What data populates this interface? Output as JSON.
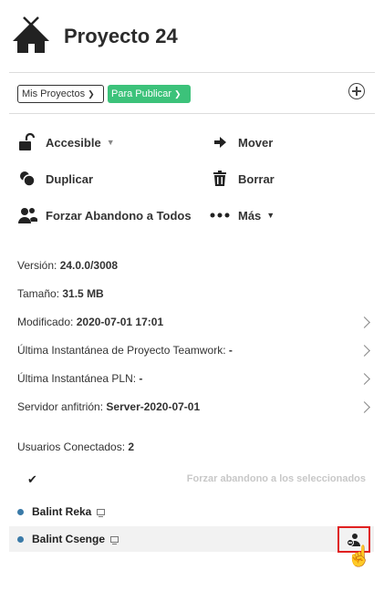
{
  "project": {
    "title": "Proyecto 24"
  },
  "filters": {
    "projects_label": "Mis Proyectos",
    "status_label": "Para Publicar"
  },
  "actions": {
    "accessible": "Accesible",
    "move": "Mover",
    "duplicate": "Duplicar",
    "delete": "Borrar",
    "force_leave_all": "Forzar Abandono a Todos",
    "more": "Más"
  },
  "info": {
    "version_label": "Versión:",
    "version_value": "24.0.0/3008",
    "size_label": "Tamaño:",
    "size_value": "31.5 MB",
    "modified_label": "Modificado:",
    "modified_value": "2020-07-01 17:01",
    "teamwork_label": "Última Instantánea de Proyecto Teamwork:",
    "teamwork_value": "-",
    "pln_label": "Última Instantánea PLN:",
    "pln_value": "-",
    "host_label": "Servidor anfitrión:",
    "host_value": "Server-2020-07-01"
  },
  "users": {
    "connected_label": "Usuarios Conectados:",
    "connected_count": "2",
    "force_selected_label": "Forzar abandono a los seleccionados",
    "list": [
      {
        "name": "Balint Reka"
      },
      {
        "name": "Balint Csenge"
      }
    ]
  },
  "colors": {
    "accent_green": "#3cc27a",
    "status_dot": "#3a7aa8",
    "highlight_border": "#e02020"
  }
}
